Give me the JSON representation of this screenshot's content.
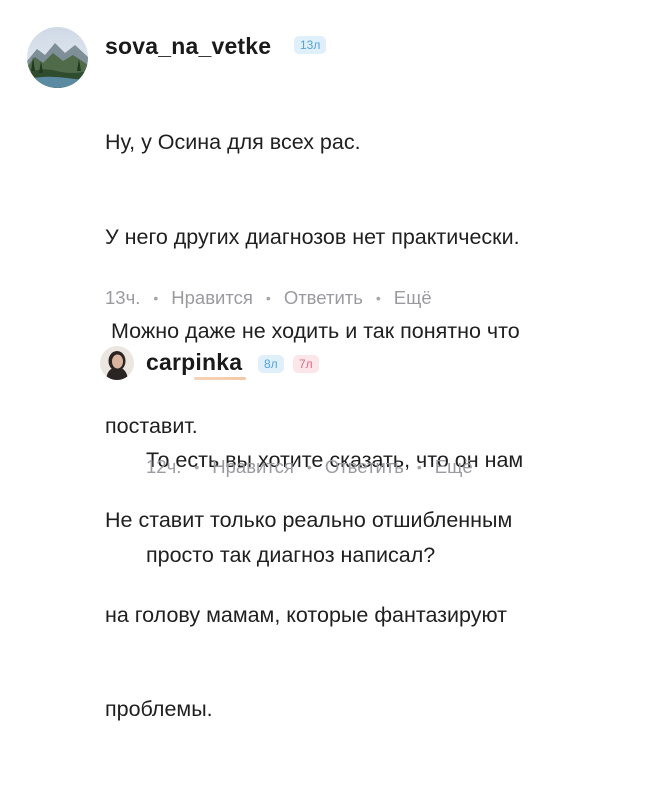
{
  "comments": [
    {
      "username": "sova_na_vetke",
      "badges": [
        "13л"
      ],
      "lines": [
        "Ну, у Осина для всех рас.",
        "У него других диагнозов нет практически.",
        " Можно даже не ходить и так понятно что",
        "поставит.",
        "Не ставит только реально отшибленным",
        "на голову мамам, которые фантазируют",
        "проблемы."
      ],
      "time": "13ч.",
      "like_label": "Нравится",
      "reply_label": "Ответить",
      "more_label": "Ещё",
      "separator": "•"
    },
    {
      "username": "carpinka",
      "badges": [
        "8л",
        "7л"
      ],
      "lines": [
        "То есть вы хотите сказать, что он нам",
        "просто так диагноз написал?"
      ],
      "time": "12ч.",
      "like_label": "Нравится",
      "reply_label": "Ответить",
      "more_label": "Ещё",
      "separator": "•"
    }
  ],
  "colors": {
    "text": "#1f1f1f",
    "meta": "#9a9aa0",
    "badge_blue_bg": "#dff0fb",
    "badge_blue_text": "#56a3d9",
    "badge_pink_bg": "#fde6ea",
    "badge_pink_text": "#e06a80"
  }
}
